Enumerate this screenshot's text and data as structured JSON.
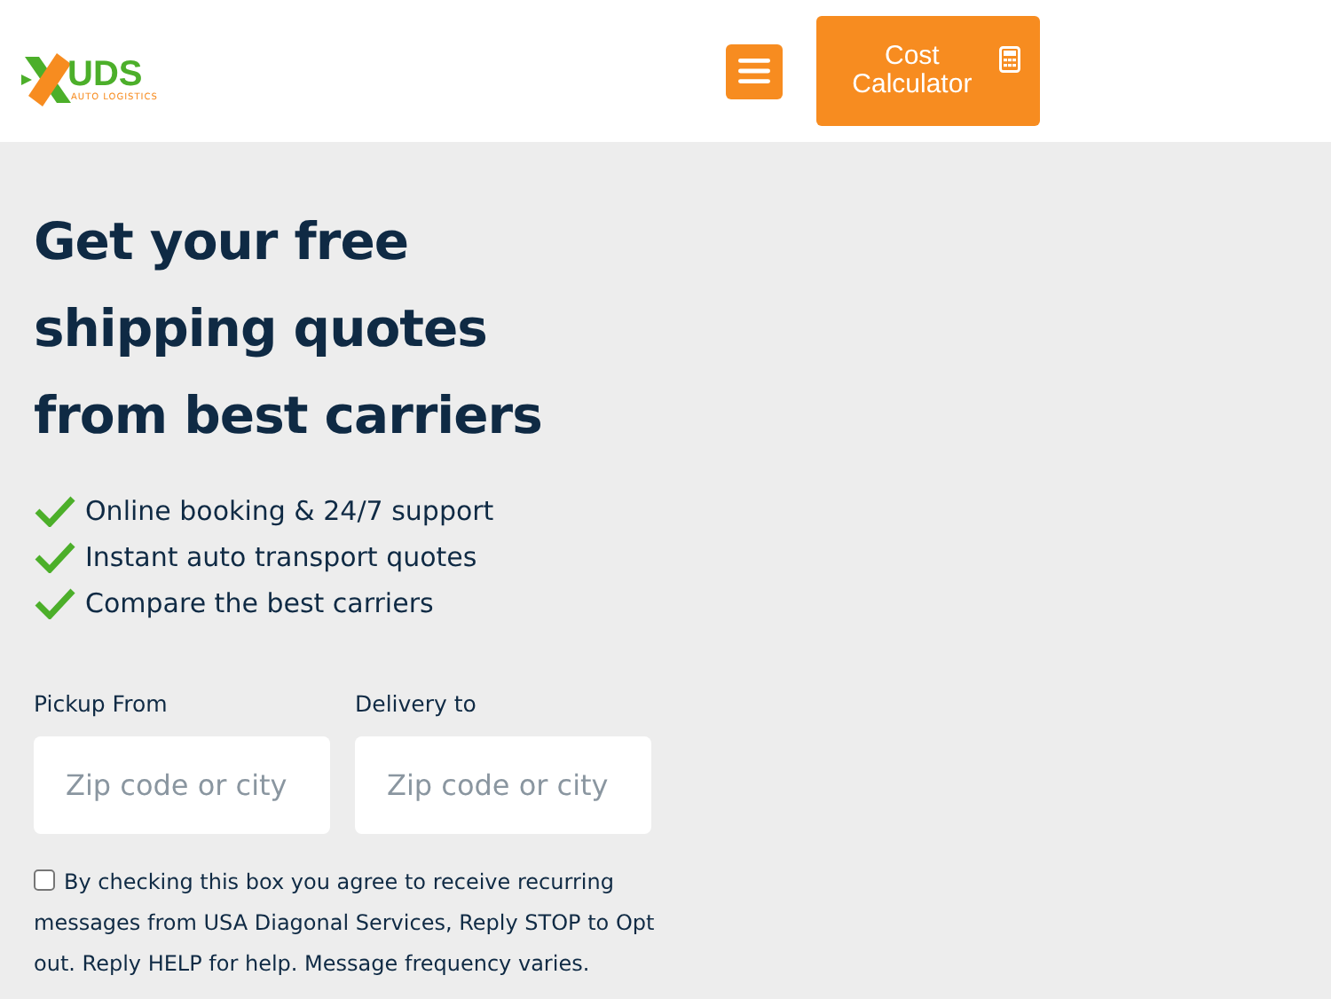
{
  "header": {
    "logo_text": "UDS",
    "logo_tagline": "AUTO LOGISTICS",
    "calculator_button": "Cost Calculator"
  },
  "heading": "Get your free shipping quotes from best carriers",
  "features": [
    "Online booking & 24/7 support",
    "Instant auto transport quotes",
    "Compare the best carriers"
  ],
  "fields": [
    {
      "label": "Pickup From",
      "placeholder": "Zip code or city"
    },
    {
      "label": "Delivery to",
      "placeholder": "Zip code or city"
    }
  ],
  "consent": {
    "checked": false,
    "text": "By checking this box you agree to receive recurring messages from USA Diagonal Services, Reply STOP to Opt out. Reply HELP for help. Message frequency varies."
  }
}
